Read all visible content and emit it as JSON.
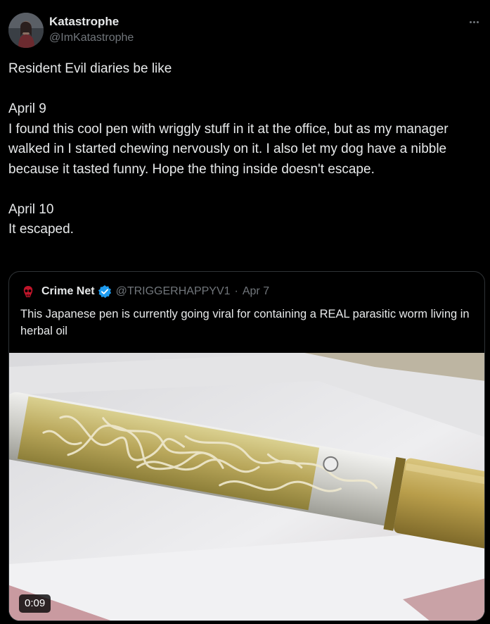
{
  "tweet": {
    "display_name": "Katastrophe",
    "handle": "@ImKatastrophe",
    "text": "Resident Evil diaries be like\n\nApril 9\nI found this cool pen with wriggly stuff in it at the office, but as my manager walked in I started chewing nervously on it. I also let my dog have a nibble because it tasted funny. Hope the thing inside doesn't escape.\n\nApril 10\nIt escaped.",
    "more_icon": "more-horizontal-icon"
  },
  "quoted": {
    "display_name": "Crime Net",
    "handle": "@TRIGGERHAPPYV1",
    "separator": "·",
    "date": "Apr 7",
    "verified_icon": "verified-badge-icon",
    "verified_color": "#1d9bf0",
    "text": "This Japanese pen is currently going viral for containing a REAL parasitic worm living in herbal oil",
    "media": {
      "duration": "0:09"
    }
  }
}
